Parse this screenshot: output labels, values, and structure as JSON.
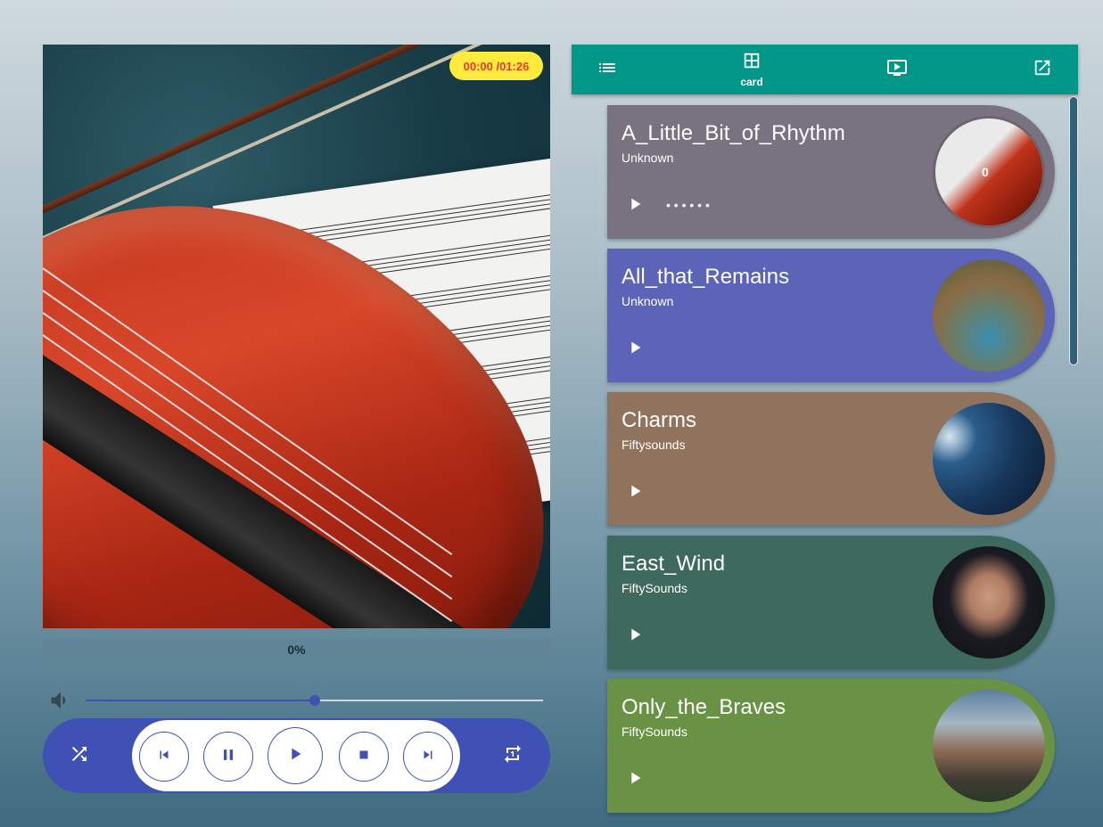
{
  "player": {
    "time_display": "00:00 /01:26",
    "progress": 0,
    "progress_label": "0%",
    "volume": 0.5,
    "accent_color": "#3f51b5",
    "badge_color": "#ffeb3b"
  },
  "controls": {
    "shuffle_icon": "shuffle-icon",
    "previous_icon": "skip-previous-icon",
    "pause_icon": "pause-icon",
    "play_icon": "play-icon",
    "stop_icon": "stop-icon",
    "next_icon": "skip-next-icon",
    "repeat_icon": "repeat-icon"
  },
  "tabs": [
    {
      "icon": "list-icon",
      "label": ""
    },
    {
      "icon": "grid-icon",
      "label": "card"
    },
    {
      "icon": "tv-play-icon",
      "label": ""
    },
    {
      "icon": "open-external-icon",
      "label": ""
    }
  ],
  "tab_color": "#009688",
  "tracks": [
    {
      "title": "A_Little_Bit_of_Rhythm",
      "artist": "Unknown",
      "color": "#797280",
      "playing": true,
      "dots": "• • • • • •",
      "thumb_label": "0"
    },
    {
      "title": "All_that_Remains",
      "artist": "Unknown",
      "color": "#5c64b7"
    },
    {
      "title": "Charms",
      "artist": "Fiftysounds",
      "color": "#8f735d"
    },
    {
      "title": "East_Wind",
      "artist": "FiftySounds",
      "color": "#3d6a5c"
    },
    {
      "title": "Only_the_Braves",
      "artist": "FiftySounds",
      "color": "#6a9245"
    }
  ]
}
